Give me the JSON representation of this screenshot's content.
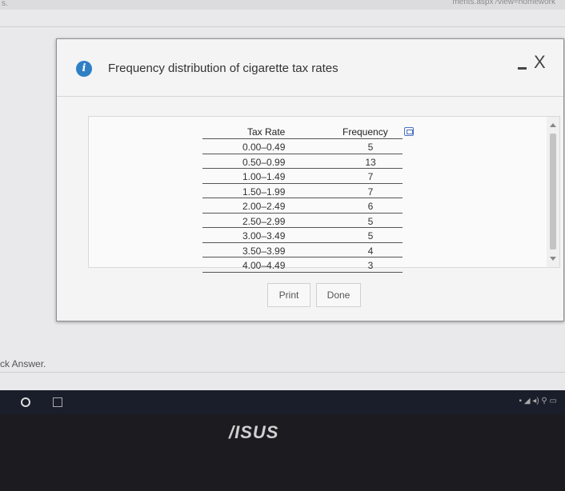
{
  "browser": {
    "url_fragment": "ments.aspx?view=homework",
    "partial_char": "s."
  },
  "page": {
    "check_answer_label": "ck Answer."
  },
  "dialog": {
    "title": "Frequency distribution of cigarette tax rates",
    "info_icon": "info-icon",
    "minimize_label": "",
    "close_label": "X",
    "print_label": "Print",
    "done_label": "Done"
  },
  "table": {
    "headers": {
      "rate": "Tax Rate",
      "frequency": "Frequency"
    },
    "rows": [
      {
        "rate": "0.00–0.49",
        "frequency": "5"
      },
      {
        "rate": "0.50–0.99",
        "frequency": "13"
      },
      {
        "rate": "1.00–1.49",
        "frequency": "7"
      },
      {
        "rate": "1.50–1.99",
        "frequency": "7"
      },
      {
        "rate": "2.00–2.49",
        "frequency": "6"
      },
      {
        "rate": "2.50–2.99",
        "frequency": "5"
      },
      {
        "rate": "3.00–3.49",
        "frequency": "5"
      },
      {
        "rate": "3.50–3.99",
        "frequency": "4"
      },
      {
        "rate": "4.00–4.49",
        "frequency": "3"
      }
    ]
  },
  "laptop": {
    "brand": "/ISUS"
  },
  "colors": {
    "info_blue": "#2f7fc5",
    "copy_icon_blue": "#4a72c0"
  }
}
